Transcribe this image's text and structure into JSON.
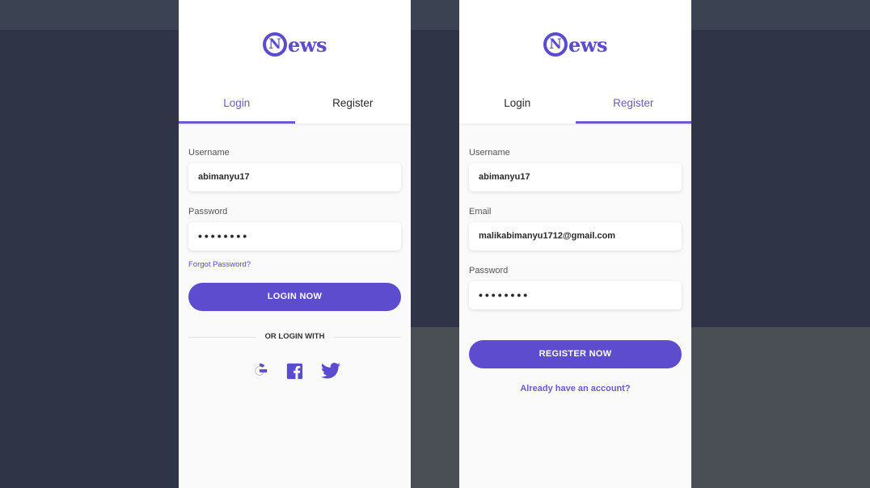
{
  "brand": {
    "logo_letter": "N",
    "logo_text": "ews",
    "color": "#5b4bce"
  },
  "login_screen": {
    "tabs": [
      {
        "label": "Login",
        "active": true
      },
      {
        "label": "Register",
        "active": false
      }
    ],
    "username_label": "Username",
    "username_value": "abimanyu17",
    "password_label": "Password",
    "password_value": "••••••••",
    "forgot_link": "Forgot Password?",
    "login_button": "LOGIN NOW",
    "divider_text": "OR LOGIN WITH",
    "social_icons": [
      "google-icon",
      "facebook-icon",
      "twitter-icon"
    ]
  },
  "register_screen": {
    "tabs": [
      {
        "label": "Login",
        "active": false
      },
      {
        "label": "Register",
        "active": true
      }
    ],
    "username_label": "Username",
    "username_value": "abimanyu17",
    "email_label": "Email",
    "email_value": "malikabimanyu1712@gmail.com",
    "password_label": "Password",
    "password_value": "••••••••",
    "register_button": "REGISTER NOW",
    "account_link": "Already have an account?"
  }
}
